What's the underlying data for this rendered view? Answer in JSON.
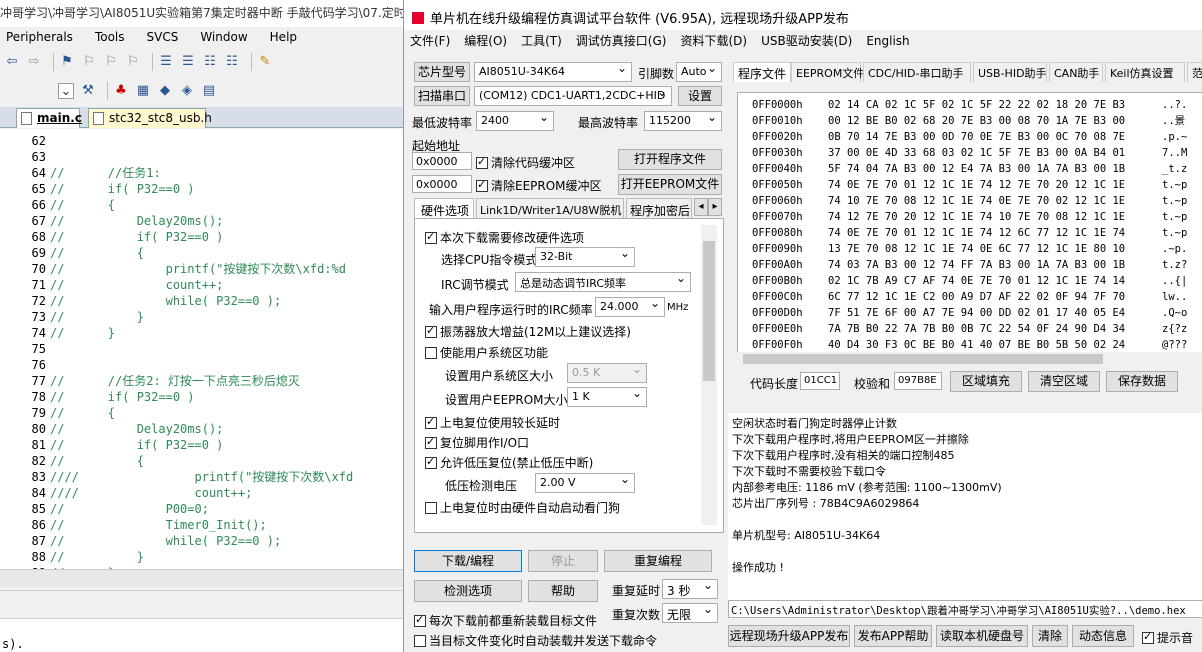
{
  "ide": {
    "title": "冲哥学习\\冲哥学习\\AI8051U实验箱第7集定时器中断 手敲代码学习\\07.定时器",
    "menu": [
      "Peripherals",
      "Tools",
      "SVCS",
      "Window",
      "Help"
    ],
    "tabs": [
      {
        "label": "main.c"
      },
      {
        "label": "stc32_stc8_usb.h"
      }
    ],
    "code": [
      {
        "n": "62",
        "t": ""
      },
      {
        "n": "63",
        "t": ""
      },
      {
        "n": "64",
        "t": "//      //任务1:"
      },
      {
        "n": "65",
        "t": "//      if( P32==0 )"
      },
      {
        "n": "66",
        "t": "//      {"
      },
      {
        "n": "67",
        "t": "//          Delay20ms();"
      },
      {
        "n": "68",
        "t": "//          if( P32==0 )"
      },
      {
        "n": "69",
        "t": "//          {"
      },
      {
        "n": "70",
        "t": "//              printf(\"按键按下次数\\xfd:%d"
      },
      {
        "n": "71",
        "t": "//              count++;"
      },
      {
        "n": "72",
        "t": "//              while( P32==0 );"
      },
      {
        "n": "73",
        "t": "//          }"
      },
      {
        "n": "74",
        "t": "//      }"
      },
      {
        "n": "75",
        "t": ""
      },
      {
        "n": "76",
        "t": ""
      },
      {
        "n": "77",
        "t": "//      //任务2: 灯按一下点亮三秒后熄灭"
      },
      {
        "n": "78",
        "t": "//      if( P32==0 )"
      },
      {
        "n": "79",
        "t": "//      {"
      },
      {
        "n": "80",
        "t": "//          Delay20ms();"
      },
      {
        "n": "81",
        "t": "//          if( P32==0 )"
      },
      {
        "n": "82",
        "t": "//          {"
      },
      {
        "n": "83",
        "t": "////                printf(\"按键按下次数\\xfd"
      },
      {
        "n": "84",
        "t": "////                count++;"
      },
      {
        "n": "85",
        "t": "//              P00=0;"
      },
      {
        "n": "86",
        "t": "//              Timer0_Init();"
      },
      {
        "n": "87",
        "t": "//              while( P32==0 );"
      },
      {
        "n": "88",
        "t": "//          }"
      },
      {
        "n": "89",
        "t": "//      }"
      }
    ],
    "output": "s)."
  },
  "stc": {
    "title": "单片机在线升级编程仿真调试平台软件 (V6.95A), 远程现场升级APP发布",
    "menu": [
      "文件(F)",
      "编程(O)",
      "工具(T)",
      "调试仿真接口(G)",
      "资料下载(D)",
      "USB驱动安装(D)",
      "English"
    ],
    "chip_label": "芯片型号",
    "chip_value": "AI8051U-34K64",
    "pin_label": "引脚数",
    "pin_value": "Auto",
    "scan_label": "扫描串口",
    "port_value": "(COM12) CDC1-UART1,2CDC+HID",
    "settings_label": "设置",
    "min_baud_label": "最低波特率",
    "min_baud": "2400",
    "max_baud_label": "最高波特率",
    "max_baud": "115200",
    "start_addr_label": "起始地址",
    "addr1": "0x0000",
    "clear_code": "清除代码缓冲区",
    "open_prog": "打开程序文件",
    "addr2": "0x0000",
    "clear_eeprom": "清除EEPROM缓冲区",
    "open_eeprom": "打开EEPROM文件",
    "opt_tabs": [
      "硬件选项",
      "Link1D/Writer1A/U8W脱机",
      "程序加密后"
    ],
    "options": {
      "modify_hw": "本次下载需要修改硬件选项",
      "cpu_mode_label": "选择CPU指令模式",
      "cpu_mode": "32-Bit",
      "irc_mode_label": "IRC调节模式",
      "irc_mode": "总是动态调节IRC频率",
      "irc_freq_label": "输入用户程序运行时的IRC频率",
      "irc_freq": "24.000",
      "irc_unit": "MHz",
      "osc_gain": "振荡器放大增益(12M以上建议选择)",
      "sys_area": "使能用户系统区功能",
      "sys_size_label": "设置用户系统区大小",
      "sys_size": "0.5 K",
      "eeprom_size_label": "设置用户EEPROM大小",
      "eeprom_size": "1   K",
      "long_reset": "上电复位使用较长延时",
      "reset_io": "复位脚用作I/O口",
      "lvd_reset": "允许低压复位(禁止低压中断)",
      "lvd_label": "低压检测电压",
      "lvd_value": "2.00 V",
      "wdt_auto": "上电复位时由硬件自动启动看门狗"
    },
    "download_btn": "下载/编程",
    "stop_btn": "停止",
    "reprogram_btn": "重复编程",
    "check_btn": "检测选项",
    "help_btn": "帮助",
    "retry_delay_label": "重复延时",
    "retry_delay": "3 秒",
    "retry_count_label": "重复次数",
    "retry_count": "无限",
    "reload_before": "每次下载前都重新装载目标文件",
    "auto_reload": "当目标文件变化时自动装载并发送下载命令",
    "right_tabs": [
      "程序文件",
      "EEPROM文件",
      "CDC/HID-串口助手",
      "USB-HID助手",
      "CAN助手",
      "Keil仿真设置",
      "范"
    ],
    "hex_rows": [
      {
        "a": "0FF0000h",
        "b": "02 14 CA 02 1C 5F 02 1C 5F 22 22 02 18 20 7E B3",
        "c": "..?."
      },
      {
        "a": "0FF0010h",
        "b": "00 12 BE B0 02 68 20 7E B3 00 08 70 1A 7E B3 00",
        "c": "..景"
      },
      {
        "a": "0FF0020h",
        "b": "0B 70 14 7E B3 00 0D 70 0E 7E B3 00 0C 70 08 7E",
        "c": ".p.~"
      },
      {
        "a": "0FF0030h",
        "b": "37 00 0E 4D 33 68 03 02 1C 5F 7E B3 00 0A B4 01",
        "c": "7..M"
      },
      {
        "a": "0FF0040h",
        "b": "5F 74 04 7A B3 00 12 E4 7A B3 00 1A 7A B3 00 1B",
        "c": "_t.z"
      },
      {
        "a": "0FF0050h",
        "b": "74 0E 7E 70 01 12 1C 1E 74 12 7E 70 20 12 1C 1E",
        "c": "t.~p"
      },
      {
        "a": "0FF0060h",
        "b": "74 10 7E 70 08 12 1C 1E 74 0E 7E 70 02 12 1C 1E",
        "c": "t.~p"
      },
      {
        "a": "0FF0070h",
        "b": "74 12 7E 70 20 12 1C 1E 74 10 7E 70 08 12 1C 1E",
        "c": "t.~p"
      },
      {
        "a": "0FF0080h",
        "b": "74 0E 7E 70 01 12 1C 1E 74 12 6C 77 12 1C 1E 74",
        "c": "t.~p"
      },
      {
        "a": "0FF0090h",
        "b": "13 7E 70 08 12 1C 1E 74 0E 6C 77 12 1C 1E 80 10",
        "c": ".~p."
      },
      {
        "a": "0FF00A0h",
        "b": "74 03 7A B3 00 12 74 FF 7A B3 00 1A 7A B3 00 1B",
        "c": "t.z?"
      },
      {
        "a": "0FF00B0h",
        "b": "02 1C 7B A9 C7 AF 74 0E 7E 70 01 12 1C 1E 74 14",
        "c": "..{|"
      },
      {
        "a": "0FF00C0h",
        "b": "6C 77 12 1C 1E C2 00 A9 D7 AF 22 02 0F 94 7F 70",
        "c": "lw.."
      },
      {
        "a": "0FF00D0h",
        "b": "7F 51 7E 6F 00 A7 7E 94 00 DD 02 01 17 40 05 E4",
        "c": ".Q~o"
      },
      {
        "a": "0FF00E0h",
        "b": "7A 7B B0 22 7A 7B B0 0B 7C 22 54 0F 24 90 D4 34",
        "c": "z{?z"
      },
      {
        "a": "0FF00F0h",
        "b": "40 D4 30 F3 0C BE B0 41 40 07 BE B0 5B 50 02 24",
        "c": "@???"
      }
    ],
    "code_len_label": "代码长度",
    "code_len": "01CC1",
    "checksum_label": "校验和",
    "checksum": "097B8E",
    "fill_btn": "区域填充",
    "clear_btn": "清空区域",
    "save_btn": "保存数据",
    "log": [
      "  空闲状态时看门狗定时器停止计数",
      "  下次下载用户程序时,将用户EEPROM区一并擦除",
      "  下次下载用户程序时,没有相关的端口控制485",
      "  下次下载时不需要校验下载口令",
      "  内部参考电压: 1186 mV (参考范围: 1100~1300mV)",
      "芯片出厂序列号 : 78B4C9A6029864",
      "",
      "  单片机型号: AI8051U-34K64",
      "",
      "操作成功 !"
    ],
    "path": "C:\\Users\\Administrator\\Desktop\\跟着冲哥学习\\冲哥学习\\AI8051U实验?..\\demo.hex",
    "bottom": {
      "remote": "远程现场升级APP发布",
      "publish_help": "发布APP帮助",
      "read_hdd": "读取本机硬盘号",
      "clear": "清除",
      "news": "动态信息",
      "sound": "提示音"
    }
  }
}
